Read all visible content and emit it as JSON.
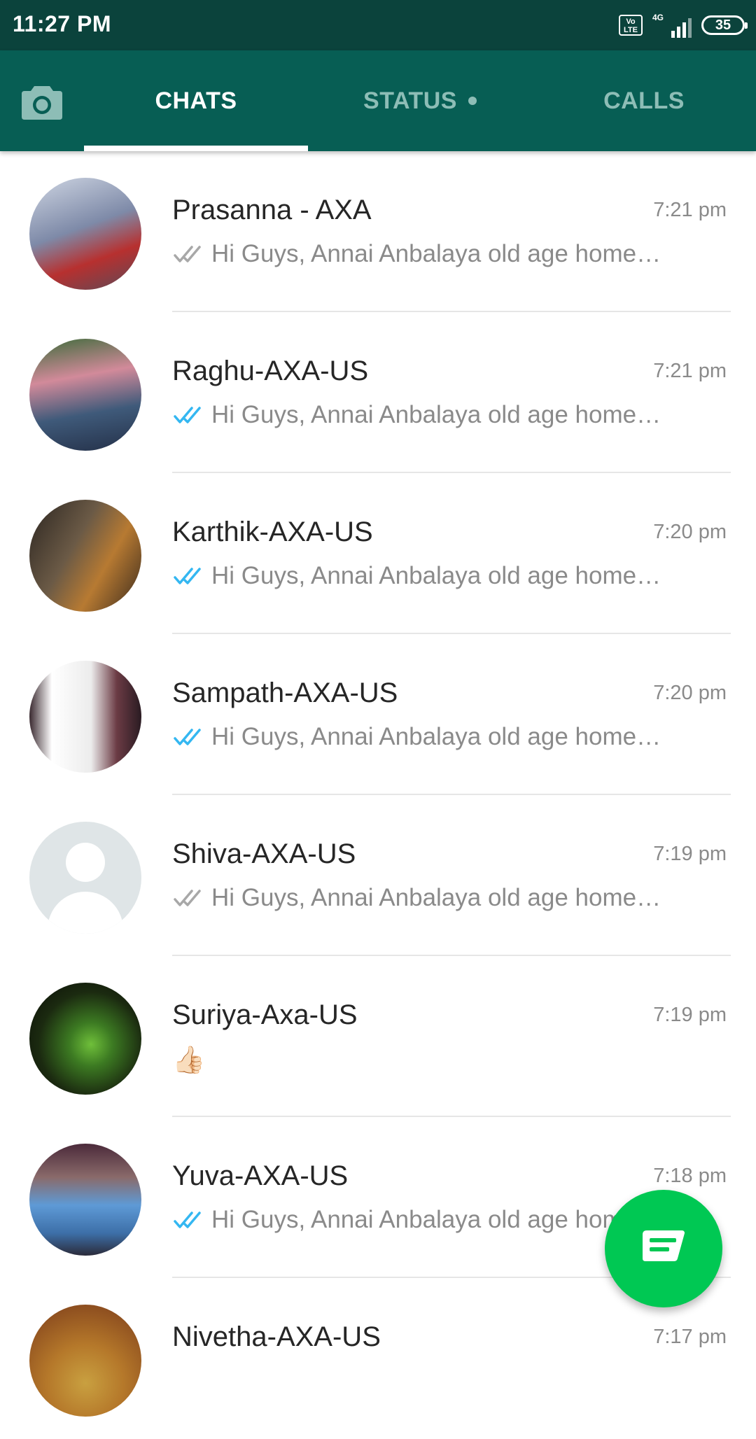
{
  "status_bar": {
    "time": "11:27 PM",
    "volte": "Vo LTE",
    "network": "4G",
    "battery": "35"
  },
  "tabs": [
    {
      "label": "CHATS",
      "active": true
    },
    {
      "label": "STATUS",
      "active": false,
      "has_dot": true
    },
    {
      "label": "CALLS",
      "active": false
    }
  ],
  "icons": {
    "camera": "camera-icon",
    "read_ticks": "double-check-icon",
    "fab": "new-chat-icon"
  },
  "colors": {
    "header": "#075e54",
    "status_bar": "#0b433c",
    "read_tick": "#34b7f1",
    "fab": "#00c853"
  },
  "chats": [
    {
      "name": "Prasanna - AXA",
      "time": "7:21 pm",
      "preview": "Hi Guys,  Annai Anbalaya old age home…",
      "ticks": "sent"
    },
    {
      "name": "Raghu-AXA-US",
      "time": "7:21 pm",
      "preview": "Hi Guys,  Annai Anbalaya old age home…",
      "ticks": "read"
    },
    {
      "name": "Karthik-AXA-US",
      "time": "7:20 pm",
      "preview": "Hi Guys,  Annai Anbalaya old age home…",
      "ticks": "read"
    },
    {
      "name": "Sampath-AXA-US",
      "time": "7:20 pm",
      "preview": "Hi Guys,  Annai Anbalaya old age home…",
      "ticks": "read"
    },
    {
      "name": "Shiva-AXA-US",
      "time": "7:19 pm",
      "preview": "Hi Guys,  Annai Anbalaya old age home…",
      "ticks": "sent"
    },
    {
      "name": "Suriya-Axa-US",
      "time": "7:19 pm",
      "preview": "👍🏻",
      "ticks": "none"
    },
    {
      "name": "Yuva-AXA-US",
      "time": "7:18 pm",
      "preview": "Hi Guys,  Annai Anbalaya old age home…",
      "ticks": "read"
    },
    {
      "name": "Nivetha-AXA-US",
      "time": "7:17 pm",
      "preview": "",
      "ticks": "none"
    }
  ]
}
